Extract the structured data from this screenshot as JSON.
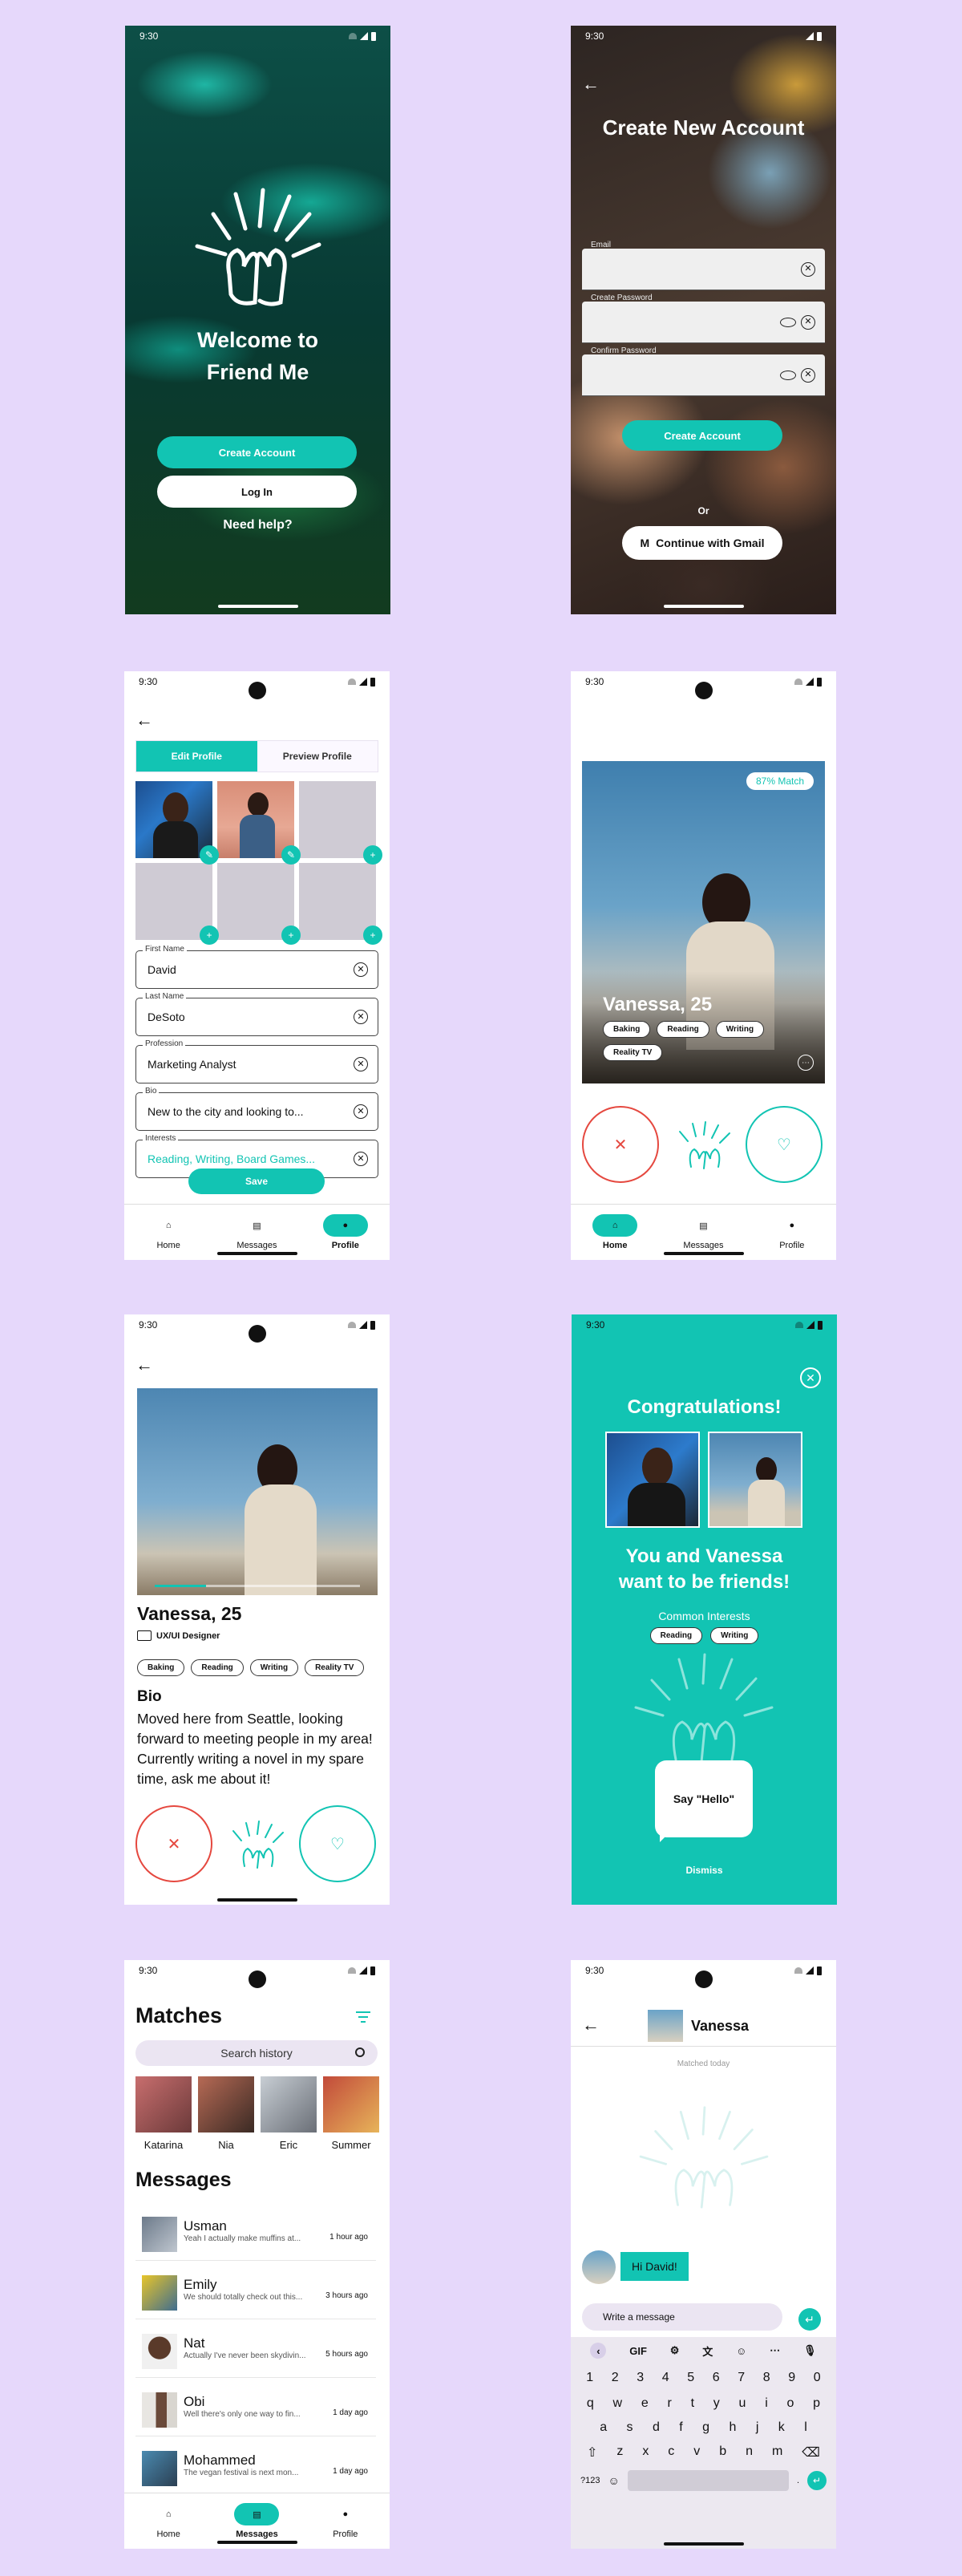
{
  "status_time": "9:30",
  "welcome": {
    "title_line1": "Welcome to",
    "title_line2": "Friend Me",
    "create_account": "Create Account",
    "log_in": "Log In",
    "need_help": "Need help?"
  },
  "create": {
    "title": "Create New Account",
    "email_label": "Email",
    "password_label": "Create Password",
    "confirm_label": "Confirm Password",
    "submit": "Create Account",
    "or": "Or",
    "gmail": "Continue with Gmail"
  },
  "edit_profile": {
    "tab_edit": "Edit Profile",
    "tab_preview": "Preview Profile",
    "fields": [
      {
        "label": "First Name",
        "value": "David"
      },
      {
        "label": "Last Name",
        "value": "DeSoto"
      },
      {
        "label": "Profession",
        "value": "Marketing Analyst"
      },
      {
        "label": "Bio",
        "value": "New to the city and looking to..."
      },
      {
        "label": "Interests",
        "value": "Reading, Writing, Board Games..."
      }
    ],
    "save": "Save"
  },
  "nav": {
    "home": "Home",
    "messages": "Messages",
    "profile": "Profile"
  },
  "match_card": {
    "match_pct": "87% Match",
    "name": "Vanessa, 25",
    "interests": [
      "Baking",
      "Reading",
      "Writing",
      "Reality TV"
    ]
  },
  "profile_detail": {
    "name": "Vanessa, 25",
    "job": "UX/UI Designer",
    "interests": [
      "Baking",
      "Reading",
      "Writing",
      "Reality TV"
    ],
    "bio_heading": "Bio",
    "bio": "Moved here from Seattle, looking forward to meeting people in my area! Currently writing a novel in my spare time, ask me about it!"
  },
  "congrats": {
    "title": "Congratulations!",
    "headline_line1": "You and Vanessa",
    "headline_line2": "want to be friends!",
    "common_interests": "Common Interests",
    "chips": [
      "Reading",
      "Writing"
    ],
    "say_hello": "Say \"Hello\"",
    "dismiss": "Dismiss"
  },
  "matches": {
    "title": "Matches",
    "search_placeholder": "Search history",
    "people": [
      "Katarina",
      "Nia",
      "Eric",
      "Summer"
    ],
    "messages_title": "Messages",
    "threads": [
      {
        "name": "Usman",
        "preview": "Yeah I actually make muffins at...",
        "time": "1 hour ago"
      },
      {
        "name": "Emily",
        "preview": "We should totally check out this...",
        "time": "3 hours ago"
      },
      {
        "name": "Nat",
        "preview": "Actually I've never been skydivin...",
        "time": "5 hours ago"
      },
      {
        "name": "Obi",
        "preview": "Well there's only one way to fin...",
        "time": "1 day ago"
      },
      {
        "name": "Mohammed",
        "preview": "The vegan festival is next mon...",
        "time": "1 day ago"
      }
    ]
  },
  "chat": {
    "name": "Vanessa",
    "matched": "Matched today",
    "bubble": "Hi David!",
    "input_placeholder": "Write a message",
    "gif": "GIF",
    "row_numbers": [
      "1",
      "2",
      "3",
      "4",
      "5",
      "6",
      "7",
      "8",
      "9",
      "0"
    ],
    "row1": [
      "q",
      "w",
      "e",
      "r",
      "t",
      "y",
      "u",
      "i",
      "o",
      "p"
    ],
    "row2": [
      "a",
      "s",
      "d",
      "f",
      "g",
      "h",
      "j",
      "k",
      "l"
    ],
    "row3": [
      "z",
      "x",
      "c",
      "v",
      "b",
      "n",
      "m"
    ],
    "symbols_key": "?123"
  },
  "colors": {
    "teal": "#12c4b3",
    "background": "#e6d8fb",
    "reject_red": "#e5483f"
  }
}
